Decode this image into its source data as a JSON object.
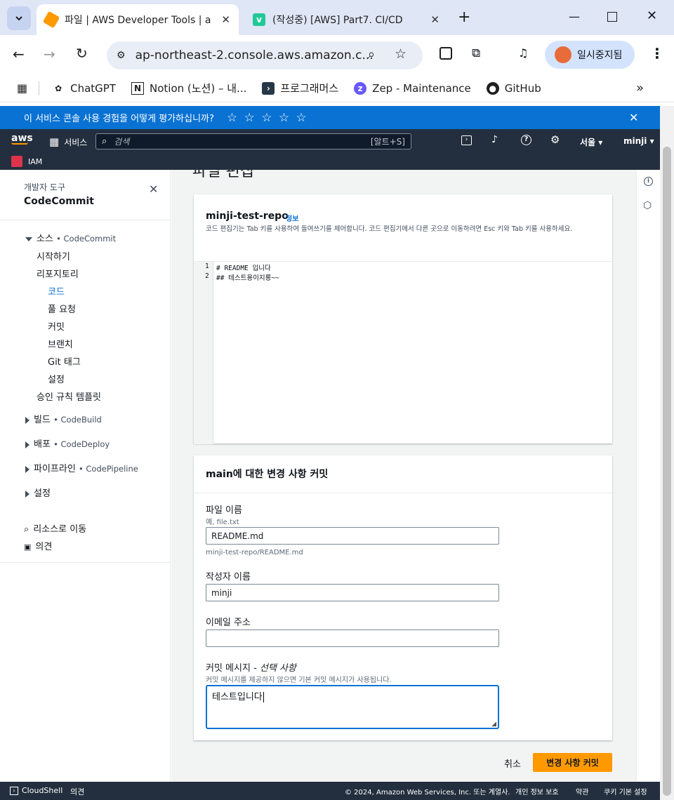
{
  "browser": {
    "tabs": [
      {
        "title": "파일 | AWS Developer Tools | a"
      },
      {
        "title": "(작성중) [AWS] Part7. CI/CD"
      }
    ],
    "url": "ap-northeast-2.console.aws.amazon.c...",
    "profile_label": "일시중지됨",
    "bookmarks": [
      {
        "label": "ChatGPT"
      },
      {
        "label": "Notion (노션) – 내..."
      },
      {
        "label": "프로그래머스"
      },
      {
        "label": "Zep - Maintenance"
      },
      {
        "label": "GitHub"
      }
    ]
  },
  "survey": {
    "text": "이 서비스 콘솔 사용 경험을 어떻게 평가하십니까?",
    "stars": "☆ ☆ ☆ ☆ ☆"
  },
  "aws_nav": {
    "logo": "aws",
    "services": "서비스",
    "search_placeholder": "검색",
    "search_shortcut": "[알트+S]",
    "region": "서울",
    "user": "minji",
    "iam_label": "IAM"
  },
  "sidebar": {
    "section_label": "개발자 도구",
    "title": "CodeCommit",
    "source": {
      "label": "소스",
      "service": "CodeCommit"
    },
    "items": [
      {
        "label": "시작하기"
      },
      {
        "label": "리포지토리"
      },
      {
        "label": "코드"
      },
      {
        "label": "풀 요청"
      },
      {
        "label": "커밋"
      },
      {
        "label": "브랜치"
      },
      {
        "label": "Git 태그"
      },
      {
        "label": "설정"
      },
      {
        "label": "승인 규칙 템플릿"
      }
    ],
    "groups": [
      {
        "label": "빌드",
        "service": "CodeBuild"
      },
      {
        "label": "배포",
        "service": "CodeDeploy"
      },
      {
        "label": "파이프라인",
        "service": "CodePipeline"
      },
      {
        "label": "설정",
        "service": ""
      }
    ],
    "goto_resource": "리소스로 이동",
    "feedback": "의견"
  },
  "main": {
    "page_title_partial": "파일 편집",
    "editor": {
      "repo_name": "minji-test-repo",
      "info_link": "정보",
      "description": "코드 편집기는 Tab 키를 사용하여 들여쓰기를 제어합니다. 코드 편집기에서 다른 곳으로 이동하려면 Esc 키와 Tab 키를 사용하세요.",
      "lines": [
        {
          "num": "1",
          "text": "# README 입니다"
        },
        {
          "num": "2",
          "text": "## 테스트용이지롱~~"
        }
      ]
    },
    "commit": {
      "heading": "main에 대한 변경 사항 커밋",
      "file_name_label": "파일 이름",
      "file_name_hint": "예, file.txt",
      "file_name_value": "README.md",
      "file_path": "minji-test-repo/README.md",
      "author_label": "작성자 이름",
      "author_value": "minji",
      "email_label": "이메일 주소",
      "email_value": "",
      "message_label": "커밋 메시지 -",
      "message_optional": "선택 사항",
      "message_hint": "커밋 메시지를 제공하지 않으면 기본 커밋 메시지가 사용됩니다.",
      "message_value": "테스트입니다"
    },
    "cancel_label": "취소",
    "commit_button_label": "변경 사항 커밋"
  },
  "footer": {
    "cloudshell": "CloudShell",
    "feedback": "의견",
    "copyright": "© 2024, Amazon Web Services, Inc. 또는 계열사.",
    "privacy": "개인 정보 보호",
    "terms": "약관",
    "cookies": "쿠키 기본 설정"
  },
  "colors": {
    "aws_nav": "#232f3e",
    "survey": "#0972d3",
    "primary_button": "#ff9900",
    "link": "#0972d3",
    "main_bg": "#f2f3f3"
  }
}
